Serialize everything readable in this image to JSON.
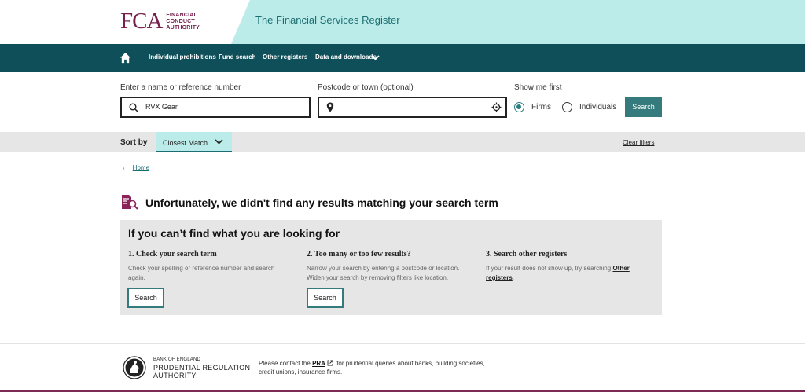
{
  "header": {
    "logo_mark": "FCA",
    "logo_text": [
      "FINANCIAL",
      "CONDUCT",
      "AUTHORITY"
    ],
    "site_title": "The Financial Services Register"
  },
  "nav": {
    "items": [
      "Individual prohibitions",
      "Fund search",
      "Other registers",
      "Data and downloads"
    ]
  },
  "search": {
    "name_label": "Enter a name or reference number",
    "name_value": "RVX Gear",
    "postcode_label": "Postcode or town (optional)",
    "postcode_value": "",
    "show_first_label": "Show me first",
    "options": [
      "Firms",
      "Individuals"
    ],
    "selected": "Firms",
    "button": "Search"
  },
  "sort": {
    "label": "Sort by",
    "value": "Closest Match",
    "clear": "Clear filters"
  },
  "breadcrumb": {
    "chevron": "‹",
    "home": "Home"
  },
  "no_results": "Unfortunately, we didn't find any results matching your search term",
  "help": {
    "title": "If you can’t find what you are looking for",
    "col1_heading": "1. Check your search term",
    "col1_text": "Check your spelling or reference number and search again.",
    "col1_button": "Search",
    "col2_heading": "2. Too many or too few results?",
    "col2_text": "Narrow your search by entering a postcode or location. Widen your search by removing filters like location.",
    "col2_button": "Search",
    "col3_heading": "3. Search other registers",
    "col3_text": "If your result does not show up, try searching",
    "col3_link": "Other registers",
    "col3_end": "."
  },
  "footer": {
    "pra_small": "BANK OF ENGLAND",
    "pra_big1": "PRUDENTIAL REGULATION",
    "pra_big2": "AUTHORITY",
    "text_before": "Please contact the",
    "pra_link": "PRA",
    "text_after": "for prudential queries about banks, building societies, credit unions, insurance firms."
  },
  "colors": {
    "brand": "#76204f",
    "nav": "#0f4f59",
    "accent": "#357a7c",
    "mint": "#bcecea"
  },
  "icons": [
    "home-icon",
    "chevron-down-icon",
    "search-icon",
    "location-pin-icon",
    "crosshair-icon",
    "no-results-icon",
    "external-link-icon",
    "pra-crest-icon"
  ]
}
